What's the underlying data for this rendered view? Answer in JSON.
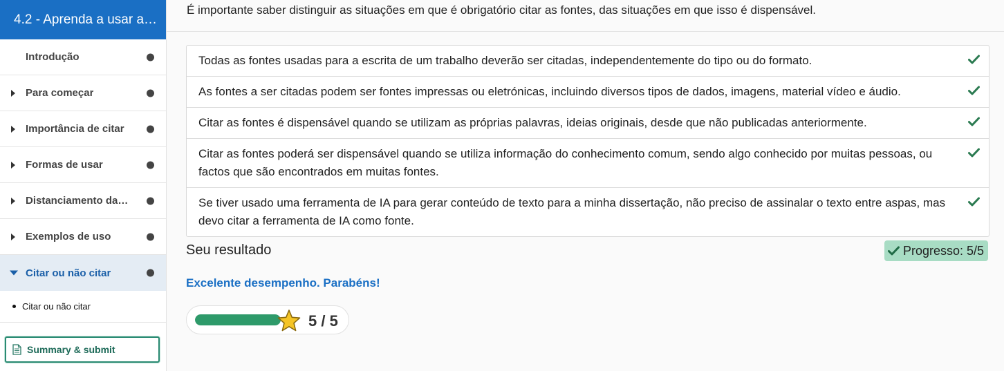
{
  "sidebar": {
    "header_title": "4.2 - Aprenda a usar a in…",
    "items": [
      {
        "label": "Introdução",
        "has_caret": false,
        "active": false
      },
      {
        "label": "Para começar",
        "has_caret": true,
        "active": false
      },
      {
        "label": "Importância de citar",
        "has_caret": true,
        "active": false
      },
      {
        "label": "Formas de usar",
        "has_caret": true,
        "active": false
      },
      {
        "label": "Distanciamento da…",
        "has_caret": true,
        "active": false
      },
      {
        "label": "Exemplos de uso",
        "has_caret": true,
        "active": false
      },
      {
        "label": "Citar ou não citar",
        "has_caret": true,
        "active": true
      }
    ],
    "subitem_label": "Citar ou não citar",
    "summary_button_label": "Summary & submit"
  },
  "main": {
    "intro_text": "É importante saber distinguir as situações em que é obrigatório citar as fontes, das situações em que isso é dispensável.",
    "statements": [
      "Todas as fontes usadas para a escrita de um trabalho deverão ser citadas, independentemente do tipo ou do formato.",
      "As fontes a ser citadas podem ser fontes impressas ou eletrónicas, incluindo diversos tipos de dados, imagens, material vídeo e áudio.",
      "Citar as fontes é dispensável quando se utilizam as próprias palavras, ideias originais, desde que não publicadas anteriormente.",
      "Citar as fontes poderá ser dispensável quando se utiliza informação do conhecimento comum, sendo algo conhecido por muitas pessoas, ou factos que são encontrados em muitas fontes.",
      "Se tiver usado uma ferramenta de IA para gerar conteúdo de texto para a minha dissertação, não preciso de assinalar o texto entre aspas, mas devo citar a ferramenta de IA como fonte."
    ],
    "result_title": "Seu resultado",
    "progress_label": "Progresso: 5/5",
    "feedback": "Excelente desempenho. Parabéns!",
    "score": {
      "achieved": 5,
      "total": 5,
      "text": "5 / 5",
      "fraction": 1.0
    }
  },
  "colors": {
    "header_blue": "#1a6fc4",
    "check_green": "#2a7a50",
    "badge_green": "#a8dcc4",
    "bar_green": "#2e9a6a",
    "feedback_blue": "#1a6fc4"
  },
  "icons": {
    "check": "check-icon",
    "star": "star-icon",
    "document": "document-icon"
  }
}
